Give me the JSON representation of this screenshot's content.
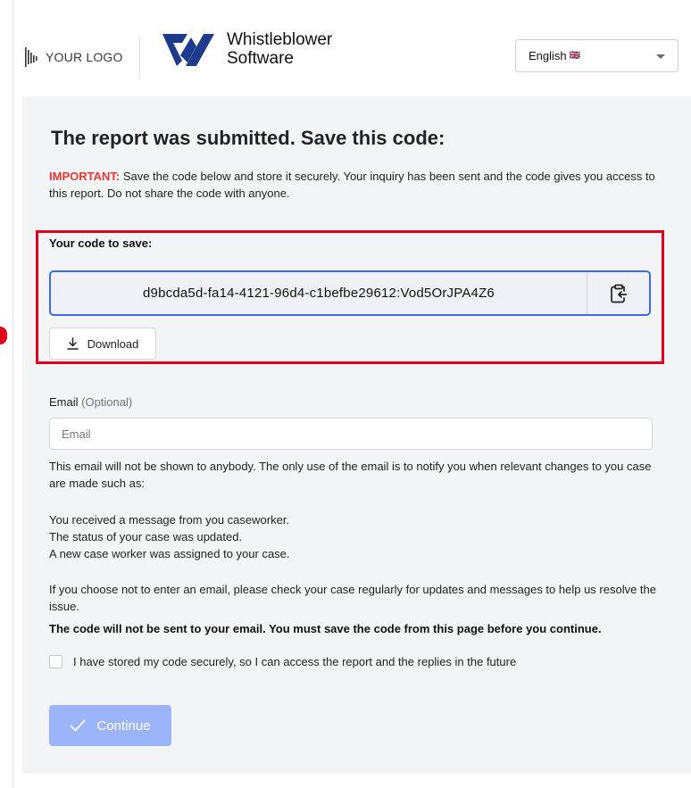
{
  "header": {
    "your_logo": "YOUR LOGO",
    "brand_line1": "Whistleblower",
    "brand_line2": "Software",
    "language": {
      "selected": "English",
      "flag": "🇬🇧"
    }
  },
  "report": {
    "title": "The report was submitted. Save this code:",
    "important_label": "IMPORTANT:",
    "important_text": " Save the code below and store it securely. Your inquiry has been sent and the code gives you access to this report. Do not share the code with anyone.",
    "code_label": "Your code to save:",
    "code_value": "d9bcda5d-fa14-4121-96d4-c1befbe29612:Vod5OrJPA4Z6",
    "download_label": "Download"
  },
  "email": {
    "label": "Email",
    "optional": "(Optional)",
    "placeholder": "Email",
    "value": "",
    "info": "This email will not be shown to anybody. The only use of the email is to notify you when relevant changes to you case are made such as:",
    "list": [
      "You received a message from you caseworker.",
      "The status of your case was updated.",
      "A new case worker was assigned to your case."
    ],
    "no_email_note": "If you choose not to enter an email, please check your case regularly for updates and messages to help us resolve the issue.",
    "warning": "The code will not be sent to your email. You must save the code from this page before you continue."
  },
  "confirm": {
    "checkbox_label": "I have stored my code securely, so I can access the report and the replies in the future",
    "checked": false
  },
  "actions": {
    "continue_label": "Continue"
  },
  "colors": {
    "accent": "#4169e1",
    "continue_disabled": "#9cb4fa",
    "important_red": "#e53935",
    "highlight_border": "#e0001b",
    "card_bg": "#f3f4f6"
  }
}
